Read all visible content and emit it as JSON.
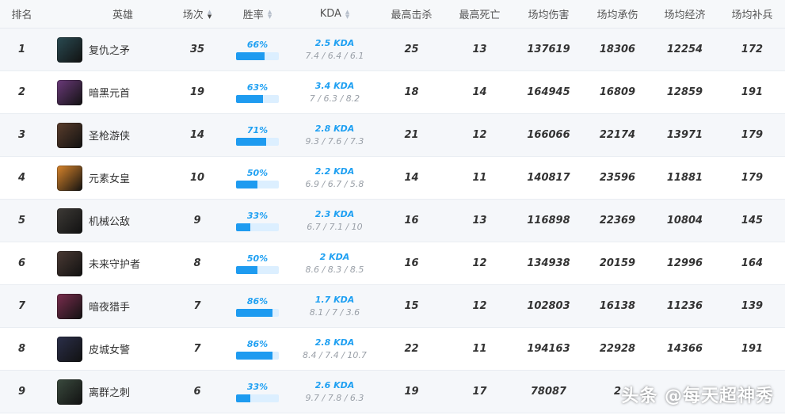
{
  "header": {
    "rank": "排名",
    "hero": "英雄",
    "games": "场次",
    "winrate": "胜率",
    "kda": "KDA",
    "max_kill": "最高击杀",
    "max_death": "最高死亡",
    "avg_damage": "场均伤害",
    "avg_taken": "场均承伤",
    "avg_gold": "场均经济",
    "avg_cs": "场均补兵"
  },
  "rows": [
    {
      "rank": "1",
      "hero": "复仇之矛",
      "games": "35",
      "winrate": "66%",
      "win_fraction": 0.66,
      "kda": "2.5 KDA",
      "kda_detail": "7.4 / 6.4 / 6.1",
      "max_kill": "25",
      "max_death": "13",
      "avg_damage": "137619",
      "avg_taken": "18306",
      "avg_gold": "12254",
      "avg_cs": "172",
      "avatar_color": "#2a4b52"
    },
    {
      "rank": "2",
      "hero": "暗黑元首",
      "games": "19",
      "winrate": "63%",
      "win_fraction": 0.63,
      "kda": "3.4 KDA",
      "kda_detail": "7 / 6.3 / 8.2",
      "max_kill": "18",
      "max_death": "14",
      "avg_damage": "164945",
      "avg_taken": "16809",
      "avg_gold": "12859",
      "avg_cs": "191",
      "avatar_color": "#6b3a7a"
    },
    {
      "rank": "3",
      "hero": "圣枪游侠",
      "games": "14",
      "winrate": "71%",
      "win_fraction": 0.71,
      "kda": "2.8 KDA",
      "kda_detail": "9.3 / 7.6 / 7.3",
      "max_kill": "21",
      "max_death": "12",
      "avg_damage": "166066",
      "avg_taken": "22174",
      "avg_gold": "13971",
      "avg_cs": "179",
      "avatar_color": "#5a3d2c"
    },
    {
      "rank": "4",
      "hero": "元素女皇",
      "games": "10",
      "winrate": "50%",
      "win_fraction": 0.5,
      "kda": "2.2 KDA",
      "kda_detail": "6.9 / 6.7 / 5.8",
      "max_kill": "14",
      "max_death": "11",
      "avg_damage": "140817",
      "avg_taken": "23596",
      "avg_gold": "11881",
      "avg_cs": "179",
      "avatar_color": "#d9852b"
    },
    {
      "rank": "5",
      "hero": "机械公敌",
      "games": "9",
      "winrate": "33%",
      "win_fraction": 0.33,
      "kda": "2.3 KDA",
      "kda_detail": "6.7 / 7.1 / 10",
      "max_kill": "16",
      "max_death": "13",
      "avg_damage": "116898",
      "avg_taken": "22369",
      "avg_gold": "10804",
      "avg_cs": "145",
      "avatar_color": "#3d3a36"
    },
    {
      "rank": "6",
      "hero": "未来守护者",
      "games": "8",
      "winrate": "50%",
      "win_fraction": 0.5,
      "kda": "2 KDA",
      "kda_detail": "8.6 / 8.3 / 8.5",
      "max_kill": "16",
      "max_death": "12",
      "avg_damage": "134938",
      "avg_taken": "20159",
      "avg_gold": "12996",
      "avg_cs": "164",
      "avatar_color": "#4a3a34"
    },
    {
      "rank": "7",
      "hero": "暗夜猎手",
      "games": "7",
      "winrate": "86%",
      "win_fraction": 0.86,
      "kda": "1.7 KDA",
      "kda_detail": "8.1 / 7 / 3.6",
      "max_kill": "15",
      "max_death": "12",
      "avg_damage": "102803",
      "avg_taken": "16138",
      "avg_gold": "11236",
      "avg_cs": "139",
      "avatar_color": "#7a2d4e"
    },
    {
      "rank": "8",
      "hero": "皮城女警",
      "games": "7",
      "winrate": "86%",
      "win_fraction": 0.86,
      "kda": "2.8 KDA",
      "kda_detail": "8.4 / 7.4 / 10.7",
      "max_kill": "22",
      "max_death": "11",
      "avg_damage": "194163",
      "avg_taken": "22928",
      "avg_gold": "14366",
      "avg_cs": "191",
      "avatar_color": "#2b2f4a"
    },
    {
      "rank": "9",
      "hero": "离群之刺",
      "games": "6",
      "winrate": "33%",
      "win_fraction": 0.33,
      "kda": "2.6 KDA",
      "kda_detail": "9.7 / 7.8 / 6.3",
      "max_kill": "19",
      "max_death": "17",
      "avg_damage": "78087",
      "avg_taken": "2",
      "avg_gold": "",
      "avg_cs": "",
      "avatar_color": "#3a4a3e"
    }
  ],
  "watermark": "头条 @每天超神秀",
  "colors": {
    "accent": "#1e9bf0",
    "bar_bg": "#dcefff",
    "row_alt": "#f5f7fa"
  }
}
